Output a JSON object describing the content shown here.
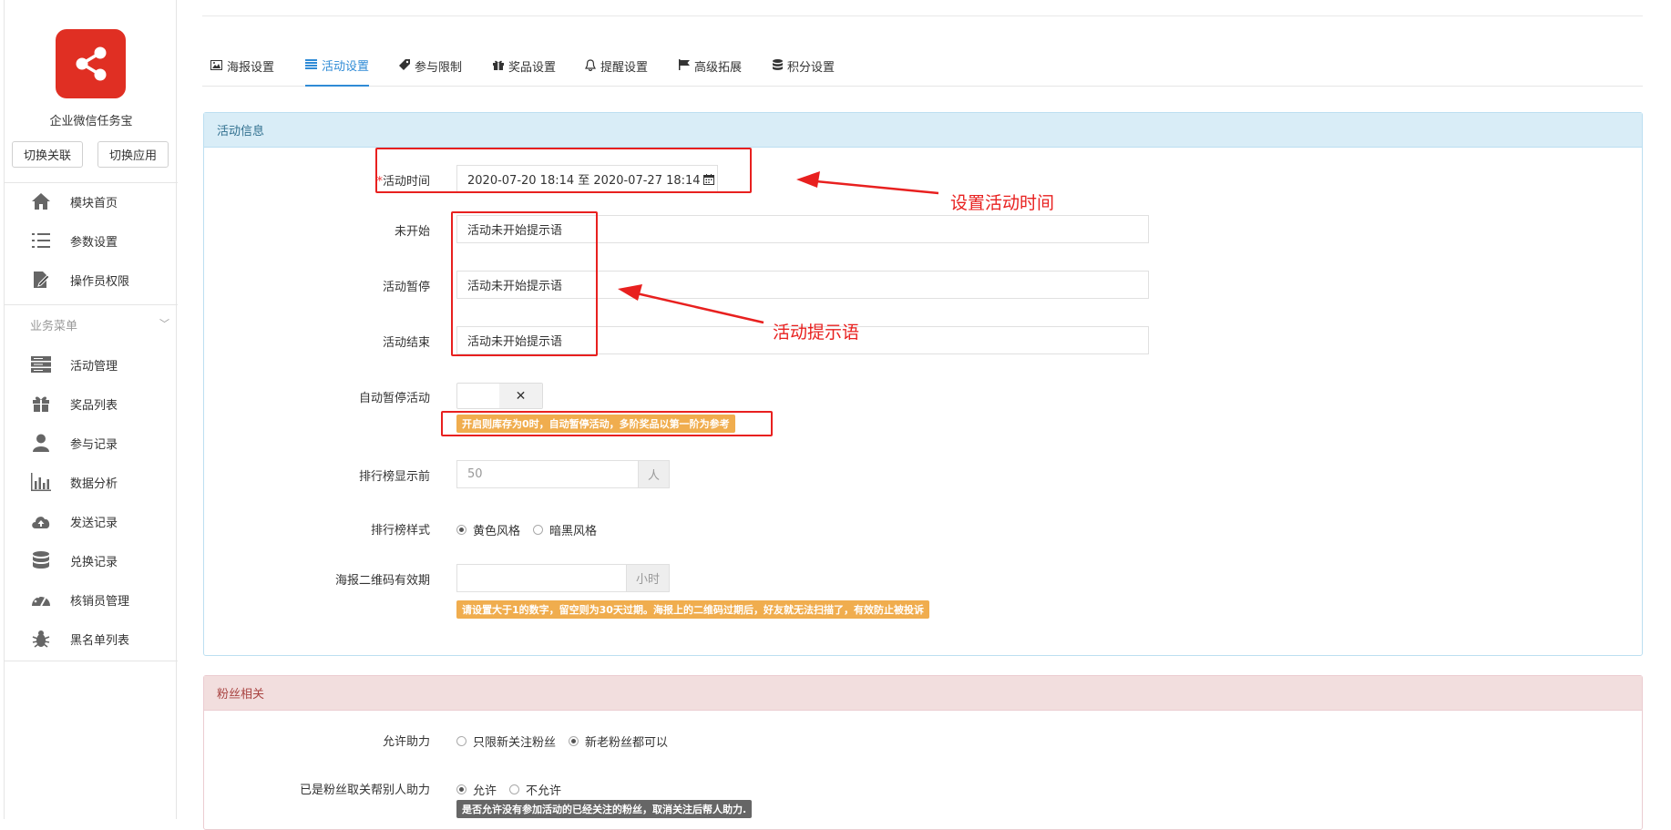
{
  "sidebar": {
    "app_title": "企业微信任务宝",
    "switch_link_label": "切换关联",
    "switch_app_label": "切换应用",
    "top_items": [
      {
        "label": "模块首页",
        "icon": "home-icon"
      },
      {
        "label": "参数设置",
        "icon": "list-icon"
      },
      {
        "label": "操作员权限",
        "icon": "edit-doc-icon"
      }
    ],
    "section_label": "业务菜单",
    "business_items": [
      {
        "label": "活动管理",
        "icon": "server-icon"
      },
      {
        "label": "奖品列表",
        "icon": "gift-icon"
      },
      {
        "label": "参与记录",
        "icon": "user-icon"
      },
      {
        "label": "数据分析",
        "icon": "bar-chart-icon"
      },
      {
        "label": "发送记录",
        "icon": "cloud-upload-icon"
      },
      {
        "label": "兑换记录",
        "icon": "database-icon"
      },
      {
        "label": "核销员管理",
        "icon": "dashboard-icon"
      },
      {
        "label": "黑名单列表",
        "icon": "bug-icon"
      }
    ]
  },
  "tabs": [
    {
      "label": "海报设置",
      "icon": "image-icon"
    },
    {
      "label": "活动设置",
      "icon": "list-alt-icon",
      "active": true
    },
    {
      "label": "参与限制",
      "icon": "tag-icon"
    },
    {
      "label": "奖品设置",
      "icon": "gift-icon"
    },
    {
      "label": "提醒设置",
      "icon": "bell-icon"
    },
    {
      "label": "高级拓展",
      "icon": "flag-icon"
    },
    {
      "label": "积分设置",
      "icon": "database-icon"
    }
  ],
  "activity_panel": {
    "title": "活动信息",
    "time_label_req": "*",
    "time_label": "活动时间",
    "time_value": "2020-07-20 18:14 至 2020-07-27 18:14",
    "not_started_label": "未开始",
    "not_started_value": "活动未开始提示语",
    "paused_label": "活动暂停",
    "paused_value": "活动未开始提示语",
    "ended_label": "活动结束",
    "ended_value": "活动未开始提示语",
    "auto_pause_label": "自动暂停活动",
    "auto_pause_toggle": "✕",
    "auto_pause_hint": "开启则库存为0时，自动暂停活动，多阶奖品以第一阶为参考",
    "rank_label": "排行榜显示前",
    "rank_value": "50",
    "rank_unit": "人",
    "rank_style_label": "排行榜样式",
    "rank_style_options": [
      {
        "label": "黄色风格",
        "checked": true
      },
      {
        "label": "暗黑风格",
        "checked": false
      }
    ],
    "qr_label": "海报二维码有效期",
    "qr_unit": "小时",
    "qr_hint": "请设置大于1的数字，留空则为30天过期。海报上的二维码过期后，好友就无法扫描了，有效防止被投诉"
  },
  "fans_panel": {
    "title": "粉丝相关",
    "allow_help_label": "允许助力",
    "allow_help_options": [
      {
        "label": "只限新关注粉丝",
        "checked": false
      },
      {
        "label": "新老粉丝都可以",
        "checked": true
      }
    ],
    "unfollow_label": "已是粉丝取关帮别人助力",
    "unfollow_options": [
      {
        "label": "允许",
        "checked": true
      },
      {
        "label": "不允许",
        "checked": false
      }
    ],
    "unfollow_hint": "是否允许没有参加活动的已经关注的粉丝，取消关注后帮人助力."
  },
  "annotations": {
    "time": "设置活动时间",
    "tips": "活动提示语"
  }
}
